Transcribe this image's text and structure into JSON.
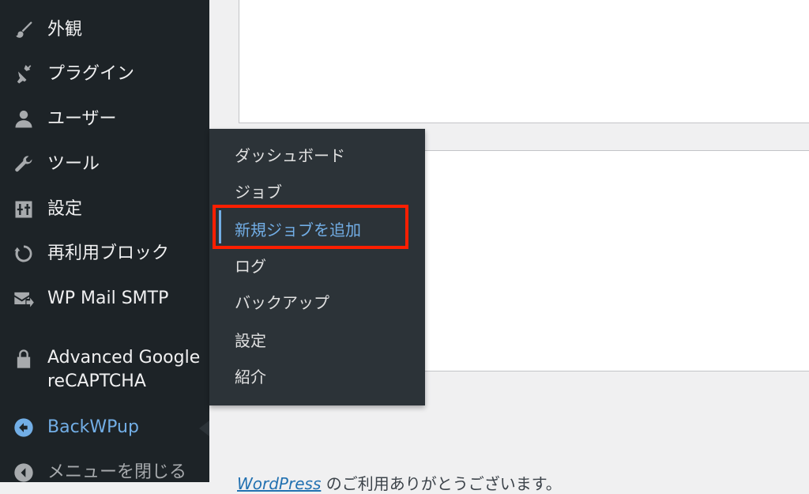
{
  "sidebar": {
    "items": [
      {
        "label": "外観",
        "icon": "paintbrush-icon"
      },
      {
        "label": "プラグイン",
        "icon": "plugin-icon"
      },
      {
        "label": "ユーザー",
        "icon": "user-icon"
      },
      {
        "label": "ツール",
        "icon": "wrench-icon"
      },
      {
        "label": "設定",
        "icon": "settings-sliders-icon"
      },
      {
        "label": "再利用ブロック",
        "icon": "reuse-arrow-icon"
      },
      {
        "label": "WP Mail SMTP",
        "icon": "mail-arrow-icon"
      },
      {
        "label_line1": "Advanced Google",
        "label_line2": "reCAPTCHA",
        "icon": "lock-icon"
      },
      {
        "label": "BackWPup",
        "icon": "backwpup-icon",
        "active": true
      },
      {
        "label": "メニューを閉じる",
        "icon": "collapse-arrow-icon"
      }
    ]
  },
  "flyout": {
    "items": [
      {
        "label": "ダッシュボード"
      },
      {
        "label": "ジョブ"
      },
      {
        "label": "新規ジョブを追加",
        "current": true
      },
      {
        "label": "ログ"
      },
      {
        "label": "バックアップ"
      },
      {
        "label": "設定"
      },
      {
        "label": "紹介"
      }
    ]
  },
  "footer": {
    "link": "WordPress",
    "text": " のご利用ありがとうございます。"
  },
  "colors": {
    "sidebar_bg": "#1d2327",
    "flyout_bg": "#2c3338",
    "accent": "#72aee6",
    "highlight": "#ff1f00"
  }
}
